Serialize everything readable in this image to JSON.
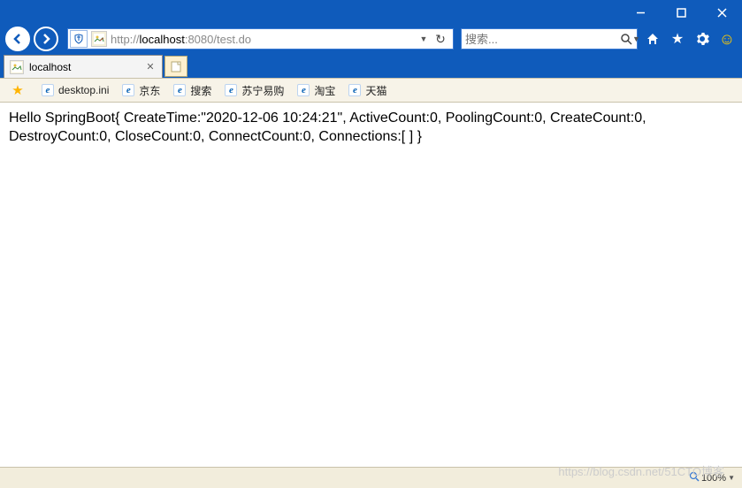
{
  "window": {
    "title": ""
  },
  "addressbar": {
    "url_prefix": "http://",
    "url_host": "localhost",
    "url_port": ":8080",
    "url_path": "/test.do"
  },
  "searchbar": {
    "placeholder": "搜索..."
  },
  "tabs": [
    {
      "title": "localhost"
    }
  ],
  "bookmarks": {
    "items": [
      {
        "label": "",
        "icon": "star"
      },
      {
        "label": "desktop.ini",
        "icon": "e"
      },
      {
        "label": "京东",
        "icon": "e"
      },
      {
        "label": "搜索",
        "icon": "e"
      },
      {
        "label": "苏宁易购",
        "icon": "e"
      },
      {
        "label": "淘宝",
        "icon": "e"
      },
      {
        "label": "天猫",
        "icon": "e"
      }
    ]
  },
  "page": {
    "body_text": "Hello SpringBoot{ CreateTime:\"2020-12-06 10:24:21\", ActiveCount:0, PoolingCount:0, CreateCount:0, DestroyCount:0, CloseCount:0, ConnectCount:0, Connections:[ ] }"
  },
  "status": {
    "zoom": "100%"
  },
  "watermark": "https://blog.csdn.net/51CTO博客"
}
